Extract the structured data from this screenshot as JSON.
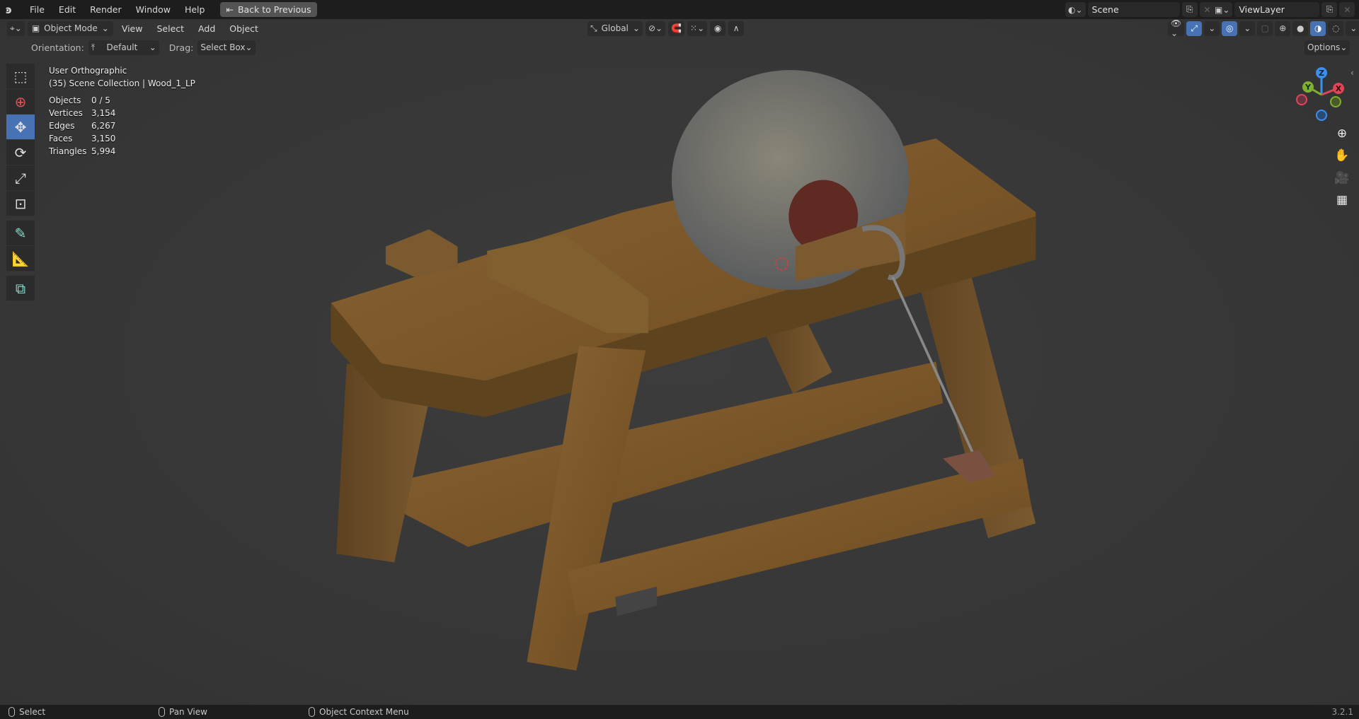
{
  "topbar": {
    "menus": [
      "File",
      "Edit",
      "Render",
      "Window",
      "Help"
    ],
    "back_button": "Back to Previous",
    "scene": "Scene",
    "view_layer": "ViewLayer"
  },
  "header": {
    "mode": "Object Mode",
    "menus": [
      "View",
      "Select",
      "Add",
      "Object"
    ],
    "transform_orientation": "Global"
  },
  "tool_settings": {
    "orientation_label": "Orientation:",
    "orientation_value": "Default",
    "drag_label": "Drag:",
    "drag_value": "Select Box",
    "options": "Options"
  },
  "overlay": {
    "view_name": "User Orthographic",
    "collection": "(35) Scene Collection | Wood_1_LP",
    "stats": [
      {
        "label": "Objects",
        "value": "0 / 5"
      },
      {
        "label": "Vertices",
        "value": "3,154"
      },
      {
        "label": "Edges",
        "value": "6,267"
      },
      {
        "label": "Faces",
        "value": "3,150"
      },
      {
        "label": "Triangles",
        "value": "5,994"
      }
    ]
  },
  "gizmo": {
    "z": "Z",
    "y": "Y",
    "x": "X"
  },
  "toolbar": [
    "select-box",
    "cursor",
    "move",
    "rotate",
    "scale",
    "transform",
    "annotate",
    "measure",
    "add-cube"
  ],
  "status": {
    "select": "Select",
    "pan": "Pan View",
    "context": "Object Context Menu",
    "version": "3.2.1"
  }
}
